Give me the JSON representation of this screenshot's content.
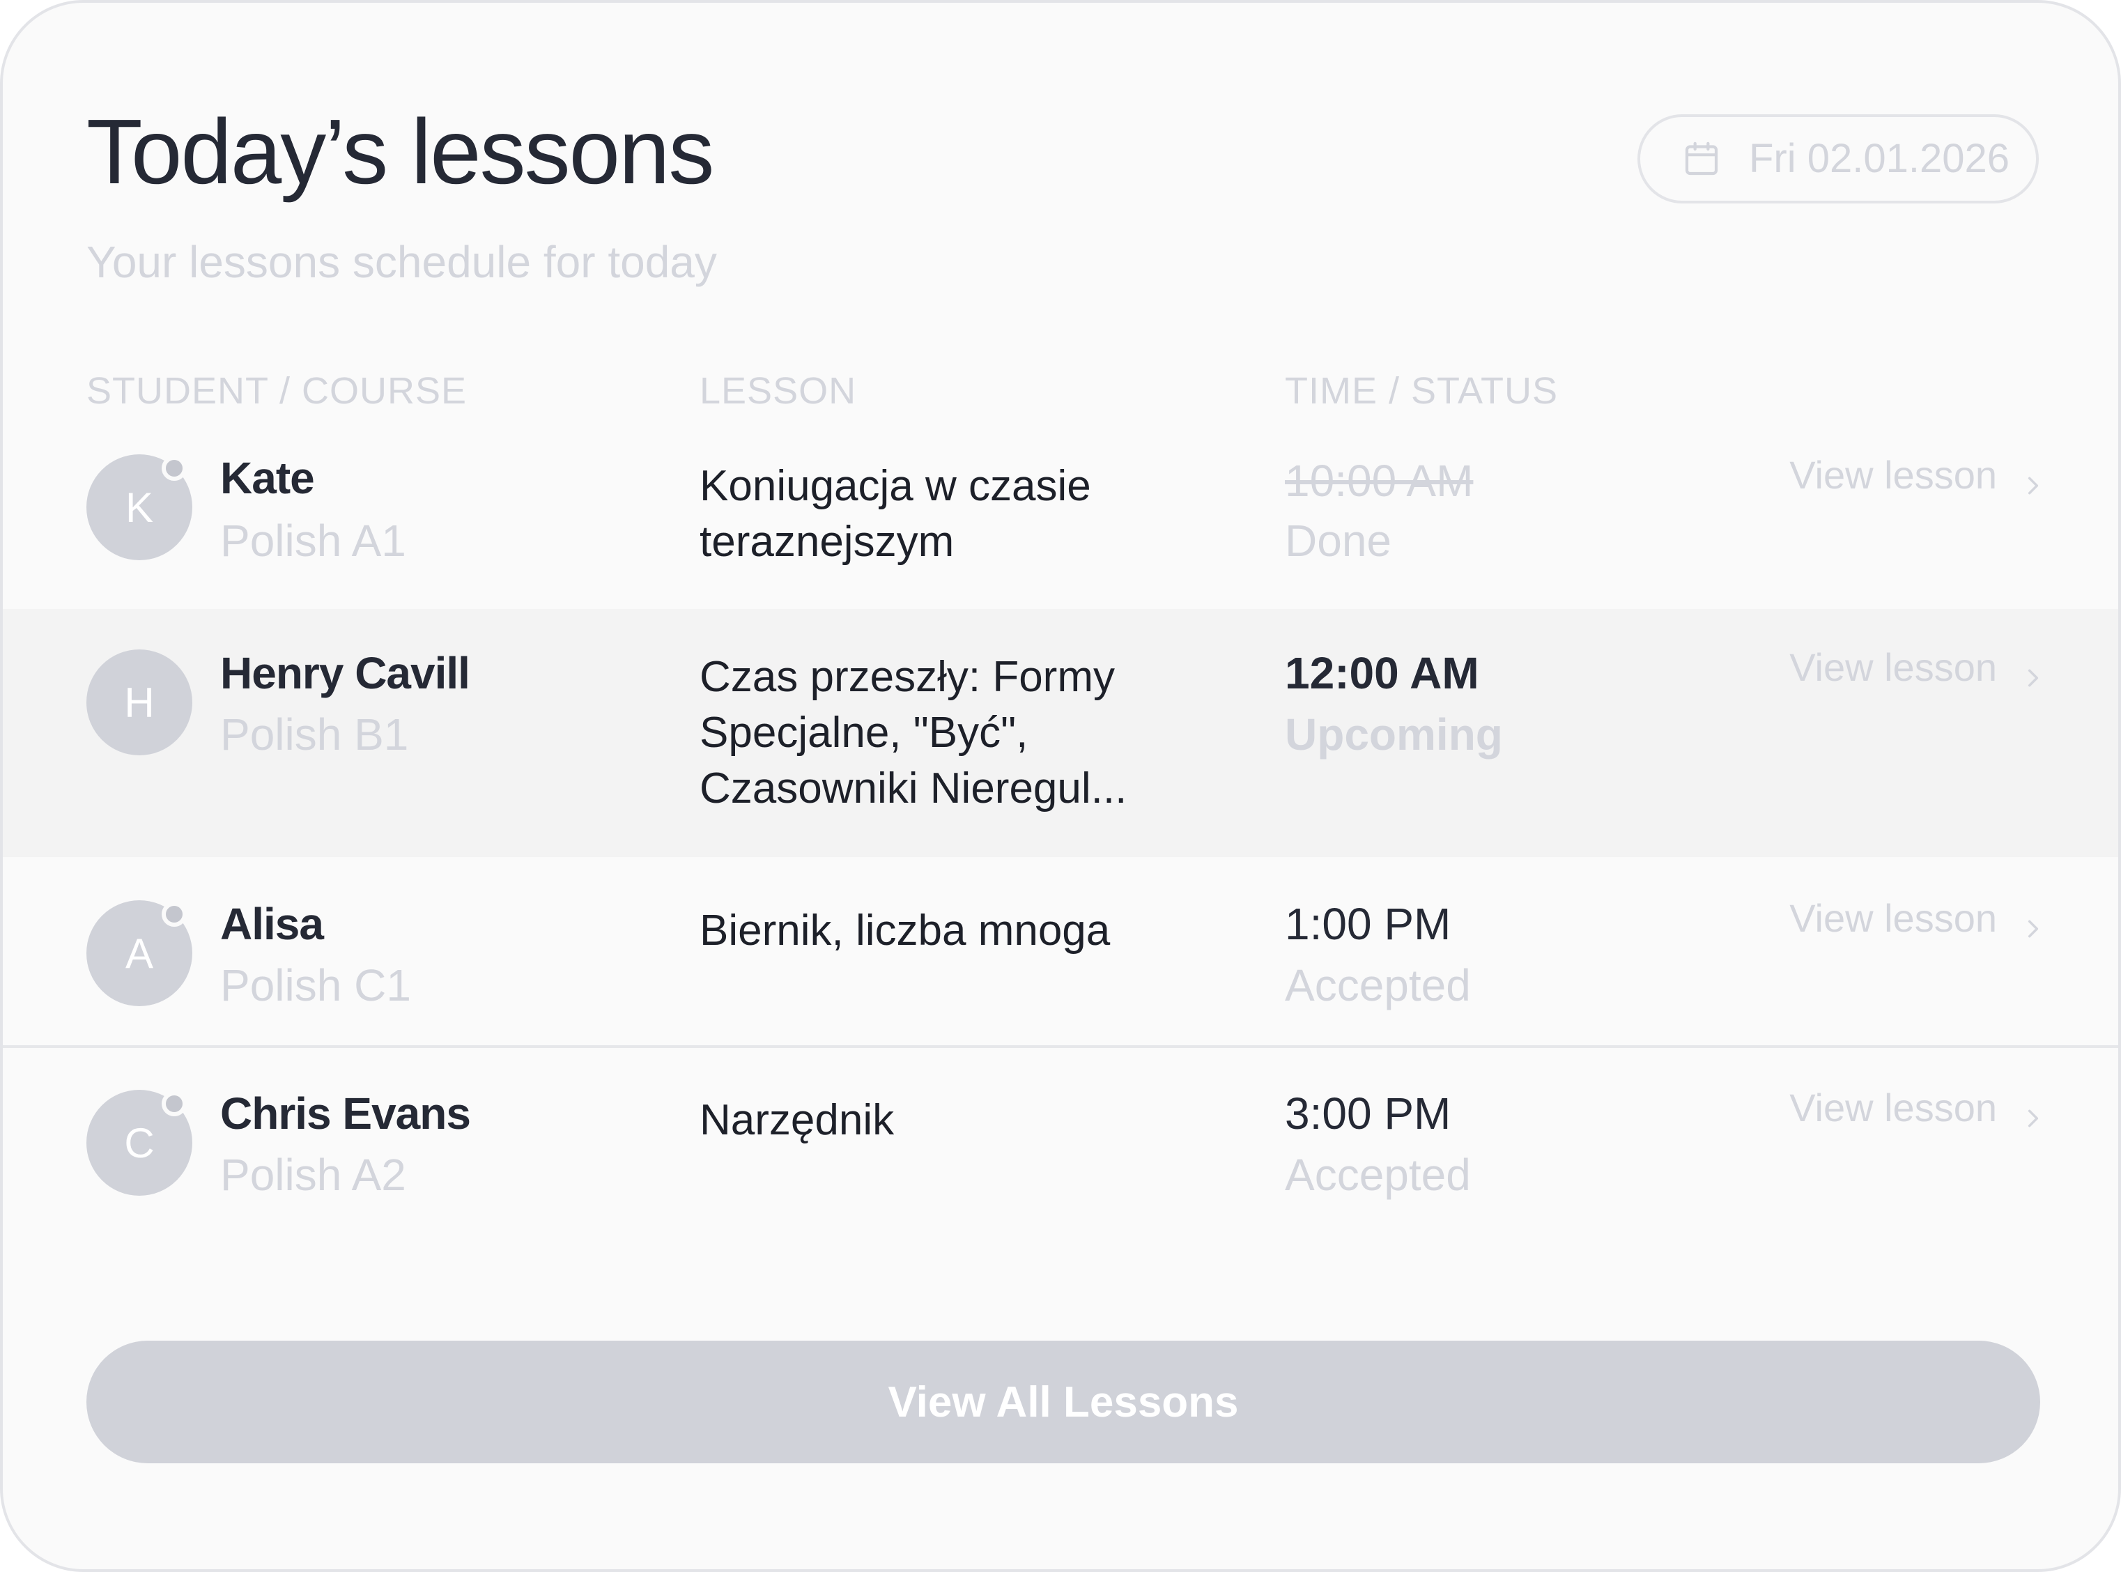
{
  "header": {
    "title": "Today’s lessons",
    "subtitle": "Your lessons schedule for today",
    "date": "Fri 02.01.2026",
    "date_icon": "calendar-icon"
  },
  "columns": {
    "student": "STUDENT / COURSE",
    "lesson": "LESSON",
    "time": "TIME / STATUS"
  },
  "lessons": [
    {
      "initial": "K",
      "name": "Kate",
      "course": "Polish A1",
      "lesson": "Koniugacja w czasie teraznejszym",
      "time": "10:00 AM",
      "status": "Done",
      "link": "View lesson"
    },
    {
      "initial": "H",
      "name": "Henry Cavill",
      "course": "Polish B1",
      "lesson": "Czas przeszły: Formy Specjalne, \"Być\", Czasowniki Nieregul...",
      "time": "12:00 AM",
      "status": "Upcoming",
      "link": "View lesson"
    },
    {
      "initial": "A",
      "name": "Alisa",
      "course": "Polish C1",
      "lesson": "Biernik, liczba mnoga",
      "time": "1:00 PM",
      "status": "Accepted",
      "link": "View lesson"
    },
    {
      "initial": "C",
      "name": "Chris Evans",
      "course": "Polish A2",
      "lesson": "Narzędnik",
      "time": "3:00 PM",
      "status": "Accepted",
      "link": "View lesson"
    }
  ],
  "footer": {
    "view_all": "View All Lessons"
  },
  "colors": {
    "background": "#fafafa",
    "title": "#252935",
    "muted": "#d3d5dc",
    "avatar": "#d0d2d9",
    "highlight_row": "#f3f3f3"
  }
}
